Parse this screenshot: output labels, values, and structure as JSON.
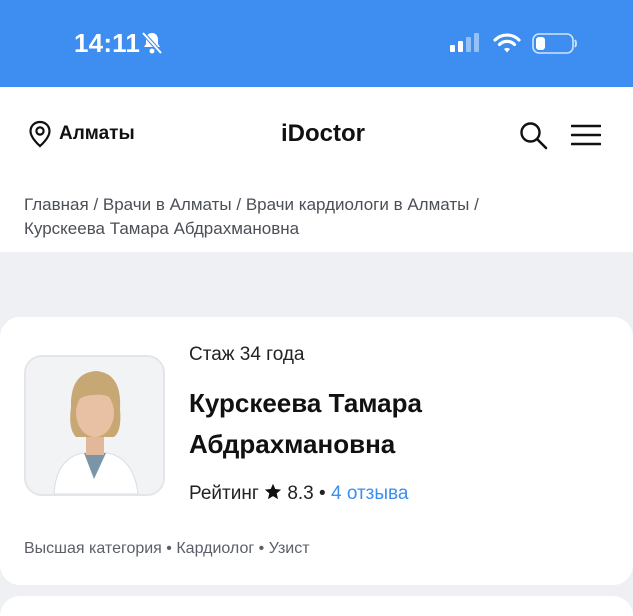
{
  "status_bar": {
    "time": "14:11",
    "icons": [
      "bell-slash-icon",
      "signal-icon",
      "wifi-icon",
      "battery-icon"
    ]
  },
  "header": {
    "city": "Алматы",
    "brand": "iDoctor",
    "icons": [
      "location-pin-icon",
      "search-icon",
      "menu-icon"
    ]
  },
  "breadcrumb": {
    "items": [
      "Главная",
      "Врачи в Алматы",
      "Врачи кардиологи в Алматы",
      "Курскеева Тамара Абдрахмановна"
    ],
    "separator": " / "
  },
  "doctor": {
    "experience": "Стаж 34 года",
    "name": "Курскеева Тамара Абдрахмановна",
    "rating_label": "Рейтинг",
    "rating_value": "8.3",
    "bullet": "•",
    "reviews": "4 отзыва",
    "tags": [
      "Высшая категория",
      "Кардиолог",
      "Узист"
    ]
  },
  "colors": {
    "accent": "#3d8ef0",
    "page_background": "#eef0f3",
    "card_background": "#ffffff"
  }
}
